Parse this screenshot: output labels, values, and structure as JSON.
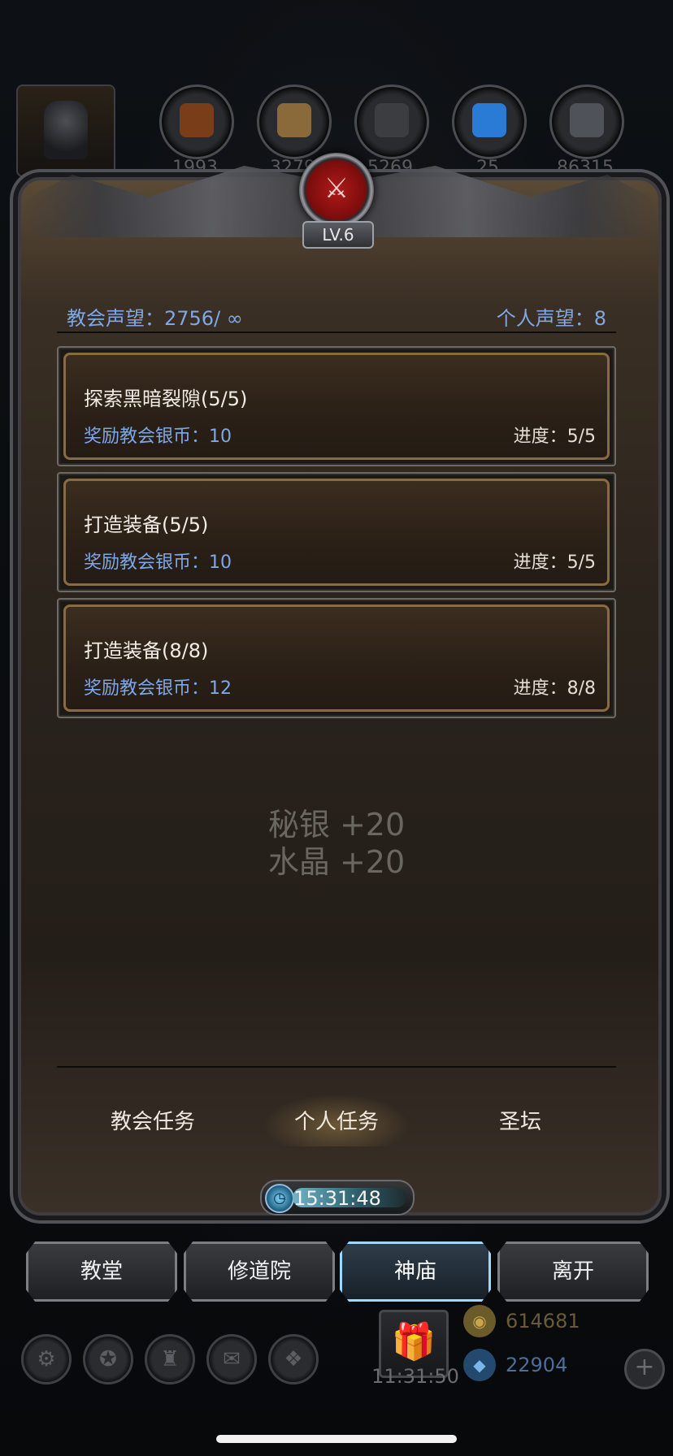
{
  "resources": [
    {
      "name": "wood-log-icon",
      "value": "1993",
      "color": "#7a3d1a"
    },
    {
      "name": "plank-icon",
      "value": "3279",
      "color": "#8a6a3a"
    },
    {
      "name": "iron-ingot-icon",
      "value": "5269",
      "color": "#3c3d40"
    },
    {
      "name": "crystal-icon",
      "value": "25",
      "color": "#2a7bd6"
    },
    {
      "name": "mithril-ingot-icon",
      "value": "86315",
      "color": "#505259"
    }
  ],
  "header": {
    "level": "LV.6",
    "church_reputation": "教会声望：2756/ ∞",
    "personal_reputation": "个人声望：8"
  },
  "quests": [
    {
      "title": "探索黑暗裂隙(5/5)",
      "reward": "奖励教会银币：10",
      "progress": "进度：5/5"
    },
    {
      "title": "打造装备(5/5)",
      "reward": "奖励教会银币：10",
      "progress": "进度：5/5"
    },
    {
      "title": "打造装备(8/8)",
      "reward": "奖励教会银币：12",
      "progress": "进度：8/8"
    }
  ],
  "reward_popup": {
    "line1": "秘银 +20",
    "line2": "水晶 +20"
  },
  "tabs": [
    {
      "label": "教会任务",
      "active": false
    },
    {
      "label": "个人任务",
      "active": true
    },
    {
      "label": "圣坛",
      "active": false
    }
  ],
  "timer": {
    "text": "15:31:48"
  },
  "nav": [
    {
      "label": "教堂",
      "active": false
    },
    {
      "label": "修道院",
      "active": false
    },
    {
      "label": "神庙",
      "active": true
    },
    {
      "label": "离开",
      "active": false
    }
  ],
  "tray": {
    "gift_time": "11:31:50",
    "gold": "614681",
    "gems": "22904"
  }
}
